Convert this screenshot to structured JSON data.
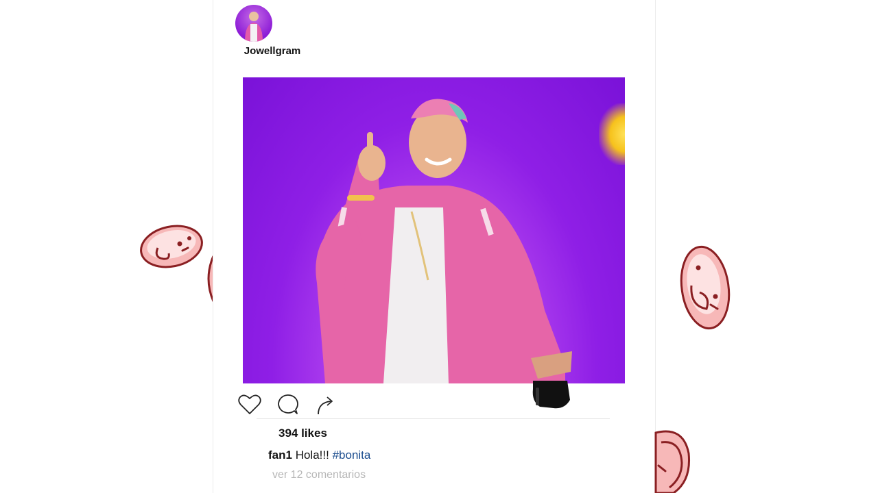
{
  "post": {
    "username": "Jowellgram",
    "likes": "394 likes",
    "caption_user": "fan1",
    "caption_text": "Hola!!!",
    "caption_hashtag": "#bonita",
    "view_comments": "ver 12 comentarios"
  },
  "actions": {
    "icons": [
      "heart-icon",
      "comment-icon",
      "share-icon"
    ]
  },
  "colors": {
    "photo_background": "#8f1fe6",
    "hashtag": "#1a4c8e",
    "muted_text": "#b7b7b7",
    "emoji_fill": "#f7b8b8",
    "emoji_stroke": "#8a1f22"
  }
}
